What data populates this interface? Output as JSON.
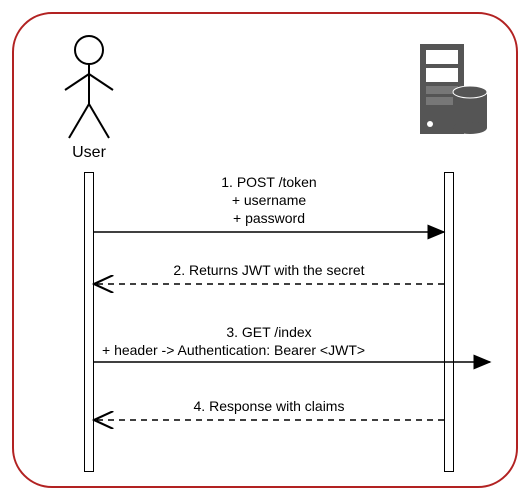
{
  "diagram": {
    "type": "sequence",
    "title": "",
    "participants": {
      "user": {
        "label": "User"
      },
      "server": {
        "label": ""
      }
    },
    "messages": {
      "m1": {
        "line1": "1. POST /token",
        "line2": "+ username",
        "line3": "+ password"
      },
      "m2": {
        "line1": "2. Returns JWT with the secret"
      },
      "m3": {
        "line1": "3. GET /index",
        "line2": "+ header -> Authentication: Bearer <JWT>"
      },
      "m4": {
        "line1": "4. Response with claims"
      }
    }
  }
}
